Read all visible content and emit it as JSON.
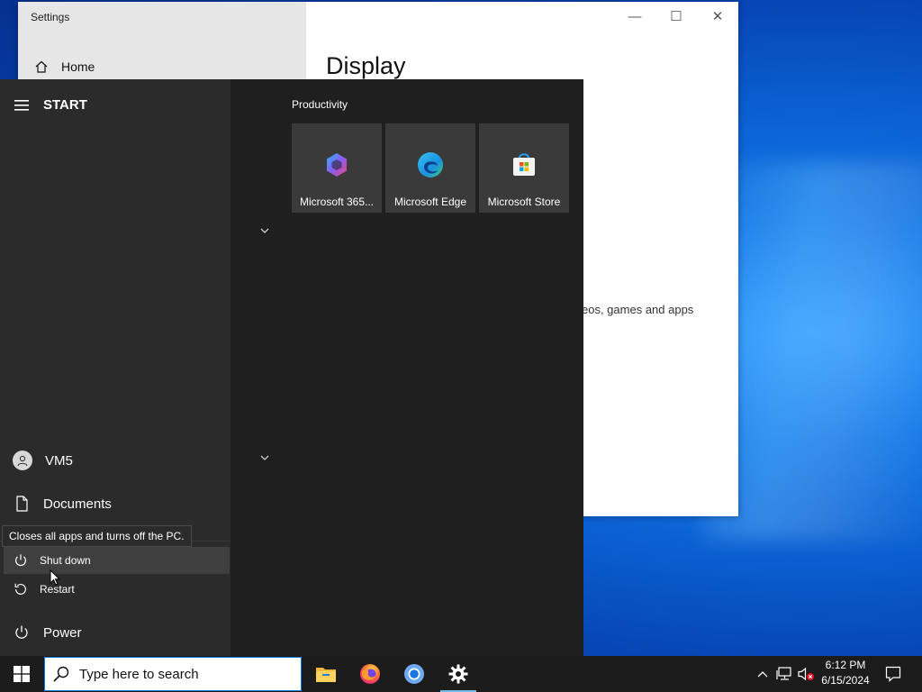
{
  "settings": {
    "title": "Settings",
    "home_label": "Home",
    "heading": "Display",
    "snippet": "eos, games and apps",
    "controls": {
      "minimize": "—",
      "maximize": "☐",
      "close": "✕"
    }
  },
  "start_menu": {
    "header": "START",
    "group_label": "Productivity",
    "tiles": [
      {
        "label": "Microsoft 365...",
        "icon": "microsoft-365-icon"
      },
      {
        "label": "Microsoft Edge",
        "icon": "edge-icon"
      },
      {
        "label": "Microsoft Store",
        "icon": "store-icon"
      }
    ],
    "rail": {
      "user": "VM5",
      "documents": "Documents",
      "power": "Power"
    },
    "power_options": {
      "shutdown": "Shut down",
      "restart": "Restart"
    },
    "tooltip": "Closes all apps and turns off the PC."
  },
  "taskbar": {
    "search_placeholder": "Type here to search",
    "apps": [
      "file-explorer-icon",
      "firefox-icon",
      "chromium-icon",
      "settings-icon"
    ],
    "clock": {
      "time": "6:12 PM",
      "date": "6/15/2024"
    }
  },
  "colors": {
    "accent": "#0078d7",
    "start_bg": "#1f1f1f",
    "rail_bg": "#2b2b2b",
    "tile_bg": "#3a3a3a"
  }
}
